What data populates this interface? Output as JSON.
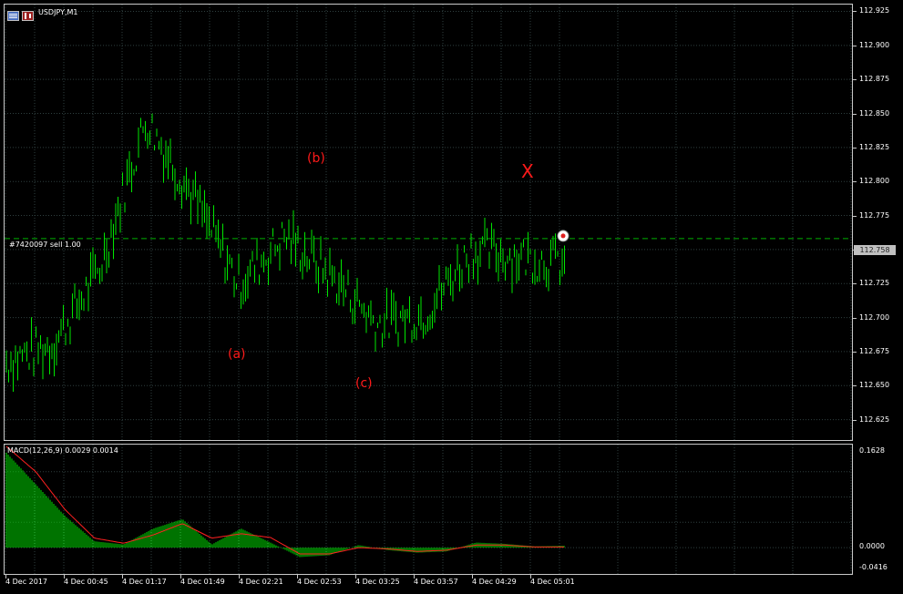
{
  "chart": {
    "symbol_label": "USDJPY,M1",
    "order_label": "#7420097 sell 1.00",
    "macd_label": "MACD(12,26,9) 0.0029 0.0014",
    "bid_label": "112.758",
    "annotations": [
      "(a)",
      "(b)",
      "(c)",
      "X"
    ]
  },
  "price_scale": [
    "112.925",
    "112.900",
    "112.875",
    "112.850",
    "112.825",
    "112.800",
    "112.775",
    "112.750",
    "112.725",
    "112.700",
    "112.675",
    "112.650",
    "112.625"
  ],
  "macd_scale": [
    "0.1628",
    "0.0000",
    "-0.0416"
  ],
  "time_axis": [
    "4 Dec 2017",
    "4 Dec 00:45",
    "4 Dec 01:17",
    "4 Dec 01:49",
    "4 Dec 02:21",
    "4 Dec 02:53",
    "4 Dec 03:25",
    "4 Dec 03:57",
    "4 Dec 04:29",
    "4 Dec 05:01"
  ],
  "colors": {
    "background": "#000000",
    "bars": "#00e600",
    "grid": "#2f3f3f",
    "order_line": "#00b000",
    "signal_line": "#ff2020",
    "annotation": "#ff1a1a"
  },
  "chart_data": {
    "type": "line",
    "title": "USDJPY,M1",
    "x": [
      "4 Dec 2017",
      "4 Dec 00:45",
      "4 Dec 01:17",
      "4 Dec 01:49",
      "4 Dec 02:21",
      "4 Dec 02:53",
      "4 Dec 03:25",
      "4 Dec 03:57",
      "4 Dec 04:29",
      "4 Dec 05:01"
    ],
    "ylim": [
      112.61,
      112.93
    ],
    "series": [
      {
        "values": [
          112.668,
          112.68,
          112.735,
          112.845,
          112.79,
          112.725,
          112.76,
          112.73,
          112.695,
          112.703,
          112.75,
          112.745,
          112.74
        ]
      }
    ],
    "macd": {
      "ylim": [
        -0.0416,
        0.1628
      ],
      "histogram": [
        0.15,
        0.1,
        0.05,
        0.01,
        0.005,
        0.03,
        0.045,
        0.005,
        0.03,
        0.008,
        -0.015,
        -0.012,
        0.004,
        -0.004,
        -0.008,
        -0.006,
        0.008,
        0.006,
        0.002,
        0.003
      ],
      "signal": [
        0.16,
        0.12,
        0.06,
        0.015,
        0.007,
        0.02,
        0.038,
        0.015,
        0.022,
        0.016,
        -0.01,
        -0.01,
        0.0,
        -0.002,
        -0.006,
        -0.004,
        0.004,
        0.004,
        0.001,
        0.001
      ]
    }
  }
}
